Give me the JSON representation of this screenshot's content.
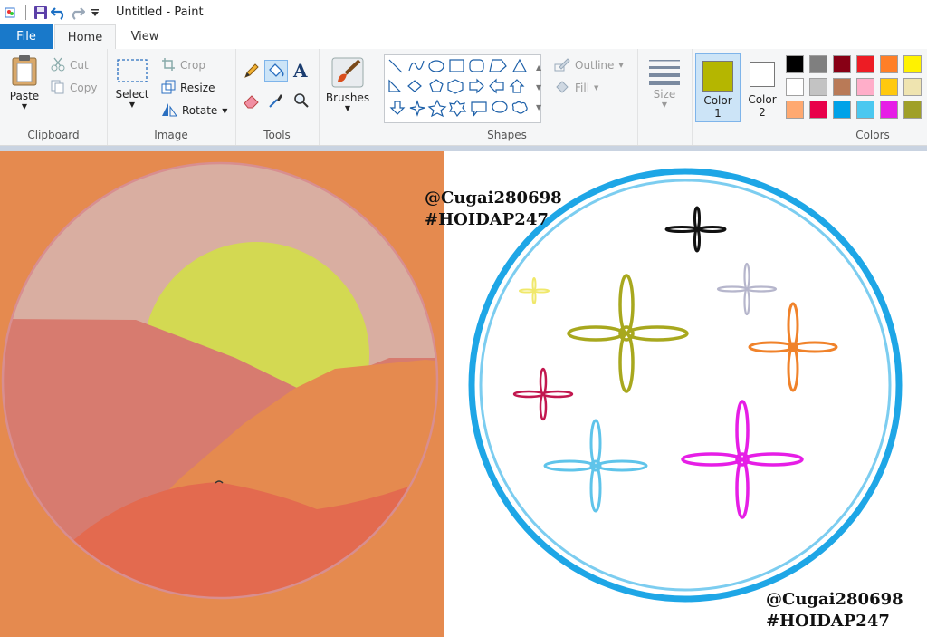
{
  "window": {
    "title": "Untitled - Paint"
  },
  "tabs": [
    {
      "label": "File"
    },
    {
      "label": "Home"
    },
    {
      "label": "View"
    }
  ],
  "groups": {
    "clipboard": {
      "label": "Clipboard",
      "paste": "Paste",
      "cut": "Cut",
      "copy": "Copy"
    },
    "image": {
      "label": "Image",
      "select": "Select",
      "crop": "Crop",
      "resize": "Resize",
      "rotate": "Rotate"
    },
    "tools": {
      "label": "Tools"
    },
    "brushes": {
      "label": "Brushes"
    },
    "shapes": {
      "label": "Shapes",
      "outline": "Outline",
      "fill": "Fill"
    },
    "size": {
      "label": "Size"
    },
    "color1": {
      "label": "Color",
      "num": "1",
      "value": "#b5b600"
    },
    "color2": {
      "label": "Color",
      "num": "2",
      "value": "#ffffff"
    },
    "colors": {
      "label": "Colors"
    }
  },
  "palette": [
    "#000000",
    "#7f7f7f",
    "#880015",
    "#ed1c24",
    "#ff7f27",
    "#fff200",
    "#ffffff",
    "#c3c3c3",
    "#b97a57",
    "#ffaec9",
    "#ffc90e",
    "#efe4b0",
    "#ffa970",
    "#e8004a",
    "#00a2e8",
    "#4bc8f0",
    "#e61ee6",
    "#a0a028"
  ],
  "canvas": {
    "watermark_handle": "@Cugai280698",
    "watermark_tag": "#HOIDAP247"
  }
}
